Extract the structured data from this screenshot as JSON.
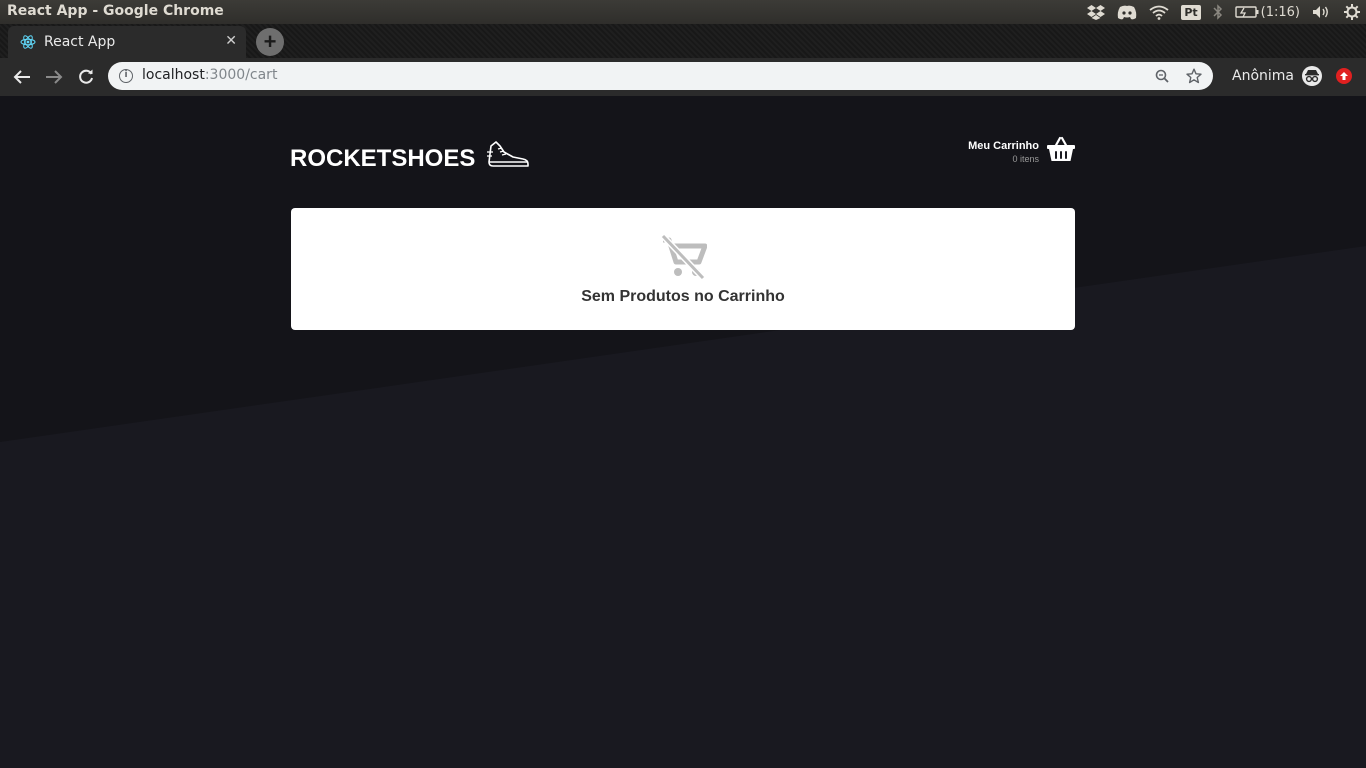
{
  "os": {
    "window_title": "React App - Google Chrome",
    "input_method": "Pt",
    "clock": "(1:16)"
  },
  "browser": {
    "tab_title": "React App",
    "url_host": "localhost",
    "url_rest": ":3000/cart",
    "profile_label": "Anônima"
  },
  "app": {
    "logo_text": "ROCKETSHOES",
    "cart_title": "Meu Carrinho",
    "cart_count": "0 itens",
    "empty_message": "Sem Produtos no Carrinho"
  },
  "colors": {
    "page_bg": "#191920",
    "band_bg": "#141419",
    "box_bg": "#ffffff",
    "muted_icon": "#bdbdbd"
  }
}
